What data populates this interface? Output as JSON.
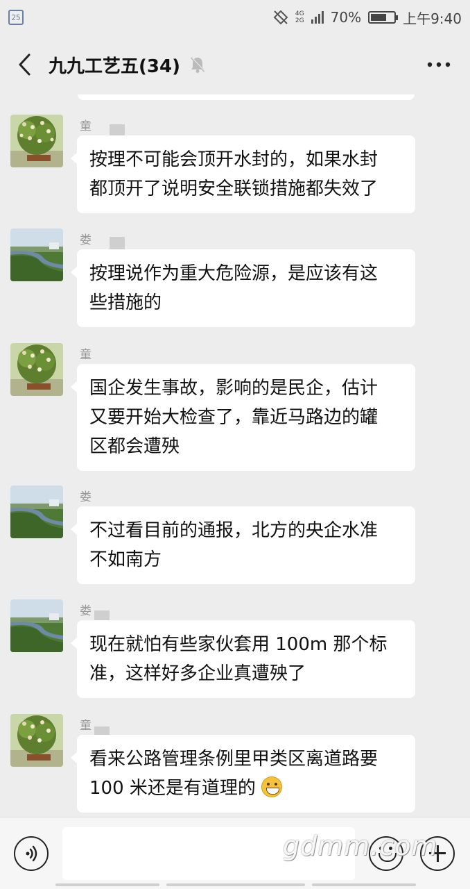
{
  "status_bar": {
    "left_badge": "25",
    "network_top": "4G",
    "network_bottom": "2G",
    "battery": "70%",
    "battery_level": 0.7,
    "time": "上午9:40"
  },
  "header": {
    "title": "九九工艺五(34)",
    "back_icon": "chevron-left-icon",
    "mute_icon": "bell-muted-icon",
    "more_icon": "more-dots-icon"
  },
  "messages": [
    {
      "sender": "童",
      "avatar": "flowering-bonsai",
      "text_lines": [
        "按理不可能会顶开水封的，如果水封",
        "都顶开了说明安全联锁措施都失效了"
      ]
    },
    {
      "sender": "娄",
      "avatar": "river-landscape",
      "text_lines": [
        "按理说作为重大危险源，是应该有这",
        "些措施的"
      ]
    },
    {
      "sender": "童",
      "avatar": "flowering-bonsai",
      "text_lines": [
        "国企发生事故，影响的是民企，估计",
        "又要开始大检查了，靠近马路边的罐",
        "区都会遭殃"
      ]
    },
    {
      "sender": "娄",
      "avatar": "river-landscape",
      "text_lines": [
        "不过看目前的通报，北方的央企水准",
        "不如南方"
      ]
    },
    {
      "sender": "娄",
      "avatar": "river-landscape",
      "text_lines": [
        "现在就怕有些家伙套用 100m 那个标",
        "准，这样好多企业真遭殃了"
      ]
    },
    {
      "sender": "童",
      "avatar": "flowering-bonsai",
      "text_lines": [
        "看来公路管理条例里甲类区离道路要",
        "100 米还是有道理的"
      ],
      "emoji": "grinning-face"
    }
  ],
  "input_bar": {
    "placeholder": "",
    "voice_icon": "voice-icon",
    "emoji_icon": "smiley-icon",
    "plus_icon": "plus-icon"
  },
  "watermark": "gdmm.com"
}
